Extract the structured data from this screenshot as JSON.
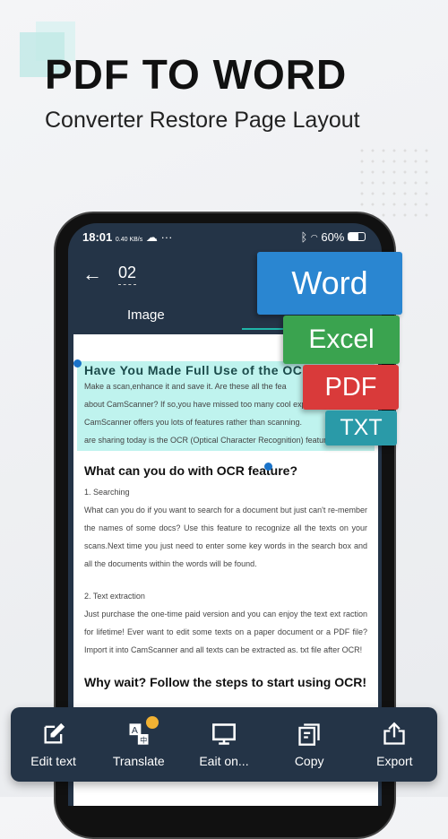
{
  "hero": {
    "title": "PDF TO WORD",
    "subtitle": "Converter Restore Page Layout"
  },
  "status": {
    "time": "18:01",
    "speed": "0.40 KB/s",
    "battery": "60%"
  },
  "header": {
    "page": "02",
    "tab": "Image"
  },
  "document": {
    "heading": "Have You Made Full Use of the OC",
    "intro": [
      "Make a scan,enhance it and save it. Are these all the fea",
      "about CamScanner? If so,you have missed too many cool expe",
      "CamScanner offers you lots of features rather than scanning.",
      "are sharing today is the OCR (Optical Character Recognition) feature."
    ],
    "h2": "What can you do with OCR feature?",
    "s1": "1. Searching",
    "p1": "What can you do if you want to search for a document but just can't re-member the names of some docs? Use this feature to recognize all the texts on your scans.Next time you just need to enter some key words in the search box and all the documents within the words will be found.",
    "s2": "2. Text extraction",
    "p2": "Just purchase the one-time paid version and you can enjoy the text ext raction for lifetime! Ever want to edit some texts on a paper document or a PDF file? Import it into CamScanner and all texts can be extracted as. txt file after OCR!",
    "h3": "Why wait? Follow the steps to start using OCR!"
  },
  "formats": [
    {
      "label": "Word",
      "color": "#2a86d1"
    },
    {
      "label": "Excel",
      "color": "#3aa34f"
    },
    {
      "label": "PDF",
      "color": "#d93a3a"
    },
    {
      "label": "TXT",
      "color": "#2a9aa8"
    }
  ],
  "toolbar": [
    {
      "label": "Edit text",
      "icon": "edit-icon"
    },
    {
      "label": "Translate",
      "icon": "translate-icon"
    },
    {
      "label": "Eait on...",
      "icon": "monitor-icon"
    },
    {
      "label": "Copy",
      "icon": "copy-icon"
    },
    {
      "label": "Export",
      "icon": "export-icon"
    }
  ]
}
